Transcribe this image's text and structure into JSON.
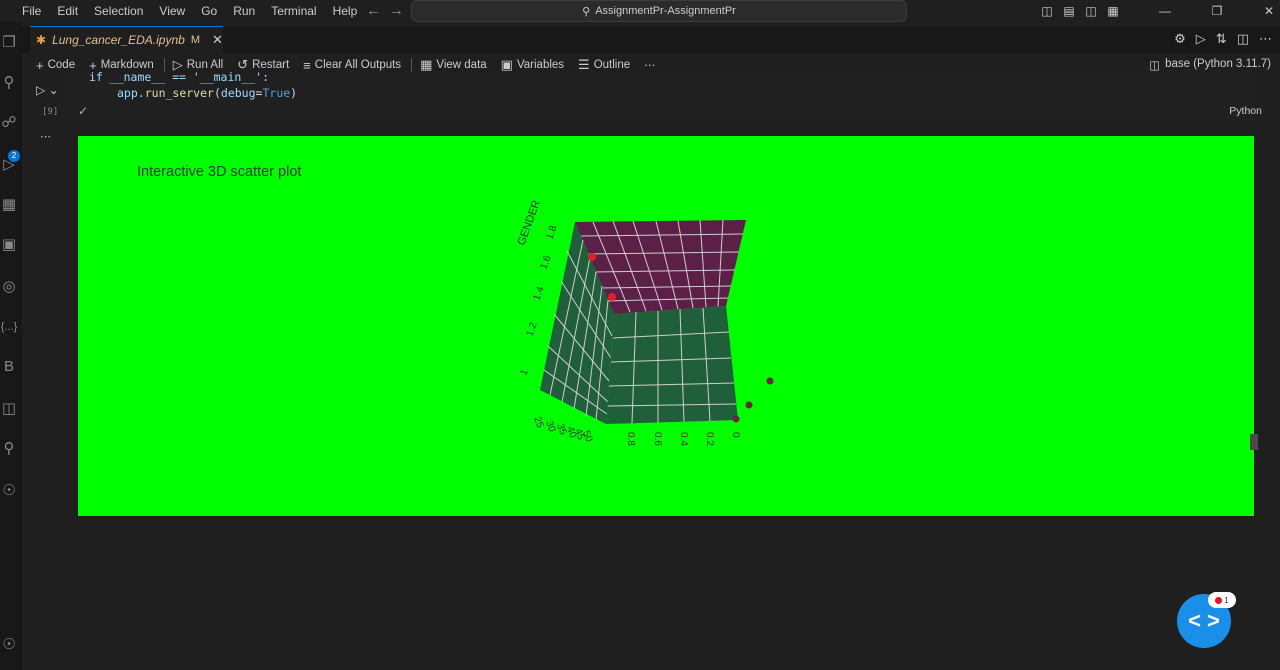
{
  "menu": [
    "File",
    "Edit",
    "Selection",
    "View",
    "Go",
    "Run",
    "Terminal",
    "Help"
  ],
  "search": {
    "text": "AssignmentPr-AssignmentPr"
  },
  "activity_badge": "2",
  "tab": {
    "name": "Lung_cancer_EDA.ipynb",
    "modified": "M"
  },
  "toolbar": {
    "code": "Code",
    "markdown": "Markdown",
    "run_all": "Run All",
    "restart": "Restart",
    "clear_outputs": "Clear All Outputs",
    "view_data": "View data",
    "variables": "Variables",
    "outline": "Outline",
    "more": "⋯",
    "kernel": "base (Python 3.11.7)"
  },
  "cell": {
    "line1": "if __name__ == '__main__':",
    "line2_obj": "app",
    "line2_fn": "run_server",
    "line2_arg": "debug",
    "line2_val": "True",
    "exec_count": "[9]",
    "language": "Python",
    "more_actions": "⋯"
  },
  "plot": {
    "title": "Interactive 3D scatter plot",
    "z_axis_title": "GENDER",
    "z_ticks": [
      "1.8",
      "1.6",
      "1.4",
      "1.2",
      "1"
    ],
    "x_ticks": [
      "25",
      "30",
      "35",
      "40",
      "45",
      "50"
    ],
    "y_ticks": [
      "0.8",
      "0.6",
      "0.4",
      "0.2",
      "0"
    ],
    "colors": {
      "background": "#00ff00",
      "top_wall": "#5c1f47",
      "side_wall": "#205e3c",
      "front_wall": "#1f5f3a",
      "point_red": "#e0202a",
      "point_dark": "#6e2440"
    }
  },
  "fab_badge": "1"
}
